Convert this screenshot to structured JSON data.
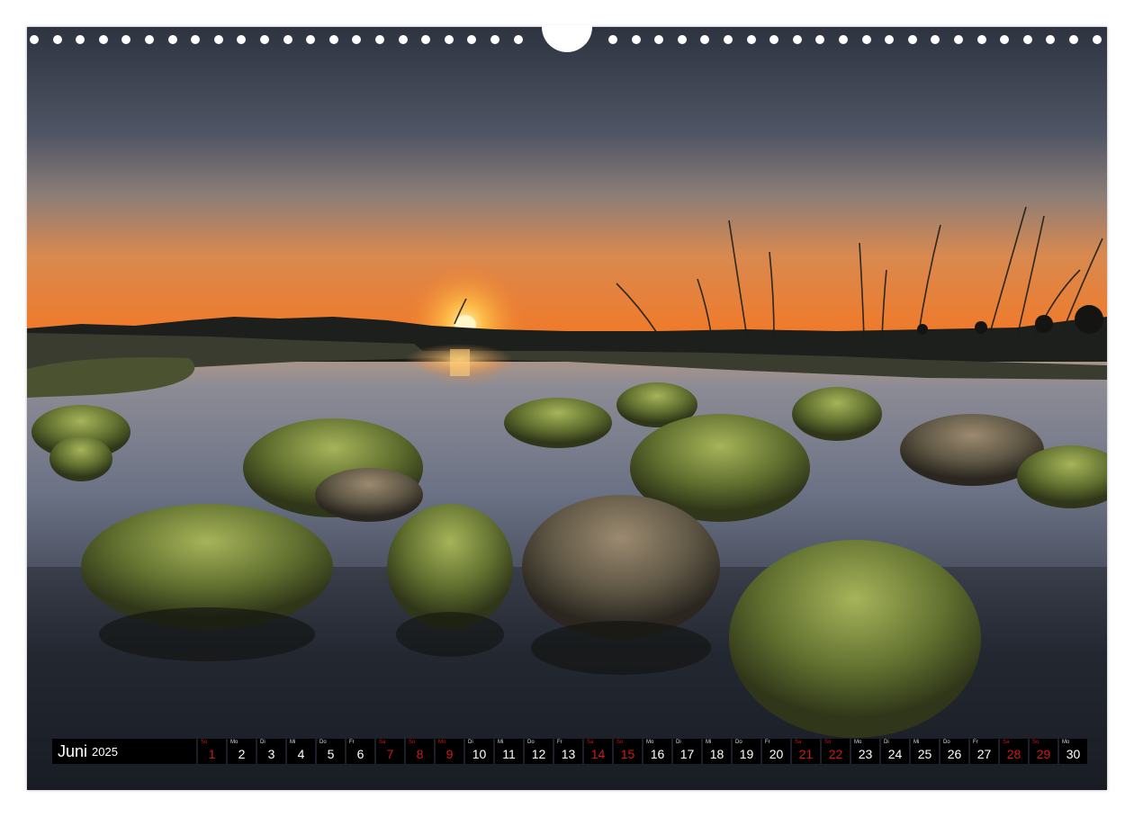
{
  "calendar": {
    "month": "Juni",
    "year": "2025",
    "weekend_color": "#d01818",
    "days": [
      {
        "wd": "So",
        "num": "1",
        "red": true
      },
      {
        "wd": "Mo",
        "num": "2",
        "red": false
      },
      {
        "wd": "Di",
        "num": "3",
        "red": false
      },
      {
        "wd": "Mi",
        "num": "4",
        "red": false
      },
      {
        "wd": "Do",
        "num": "5",
        "red": false
      },
      {
        "wd": "Fr",
        "num": "6",
        "red": false
      },
      {
        "wd": "Sa",
        "num": "7",
        "red": true
      },
      {
        "wd": "So",
        "num": "8",
        "red": true
      },
      {
        "wd": "Mo",
        "num": "9",
        "red": true
      },
      {
        "wd": "Di",
        "num": "10",
        "red": false
      },
      {
        "wd": "Mi",
        "num": "11",
        "red": false
      },
      {
        "wd": "Do",
        "num": "12",
        "red": false
      },
      {
        "wd": "Fr",
        "num": "13",
        "red": false
      },
      {
        "wd": "Sa",
        "num": "14",
        "red": true
      },
      {
        "wd": "So",
        "num": "15",
        "red": true
      },
      {
        "wd": "Mo",
        "num": "16",
        "red": false
      },
      {
        "wd": "Di",
        "num": "17",
        "red": false
      },
      {
        "wd": "Mi",
        "num": "18",
        "red": false
      },
      {
        "wd": "Do",
        "num": "19",
        "red": false
      },
      {
        "wd": "Fr",
        "num": "20",
        "red": false
      },
      {
        "wd": "Sa",
        "num": "21",
        "red": true
      },
      {
        "wd": "So",
        "num": "22",
        "red": true
      },
      {
        "wd": "Mo",
        "num": "23",
        "red": false
      },
      {
        "wd": "Di",
        "num": "24",
        "red": false
      },
      {
        "wd": "Mi",
        "num": "25",
        "red": false
      },
      {
        "wd": "Do",
        "num": "26",
        "red": false
      },
      {
        "wd": "Fr",
        "num": "27",
        "red": false
      },
      {
        "wd": "Sa",
        "num": "28",
        "red": true
      },
      {
        "wd": "So",
        "num": "29",
        "red": true
      },
      {
        "wd": "Mo",
        "num": "30",
        "red": false
      }
    ]
  },
  "photo": {
    "subject": "moor-sunset-icon",
    "sky_top": "#2f3441",
    "sky_horizon": "#f07a2a",
    "sun": "#ffd060",
    "water": "#20242c",
    "grass": "#6f8a3a"
  }
}
